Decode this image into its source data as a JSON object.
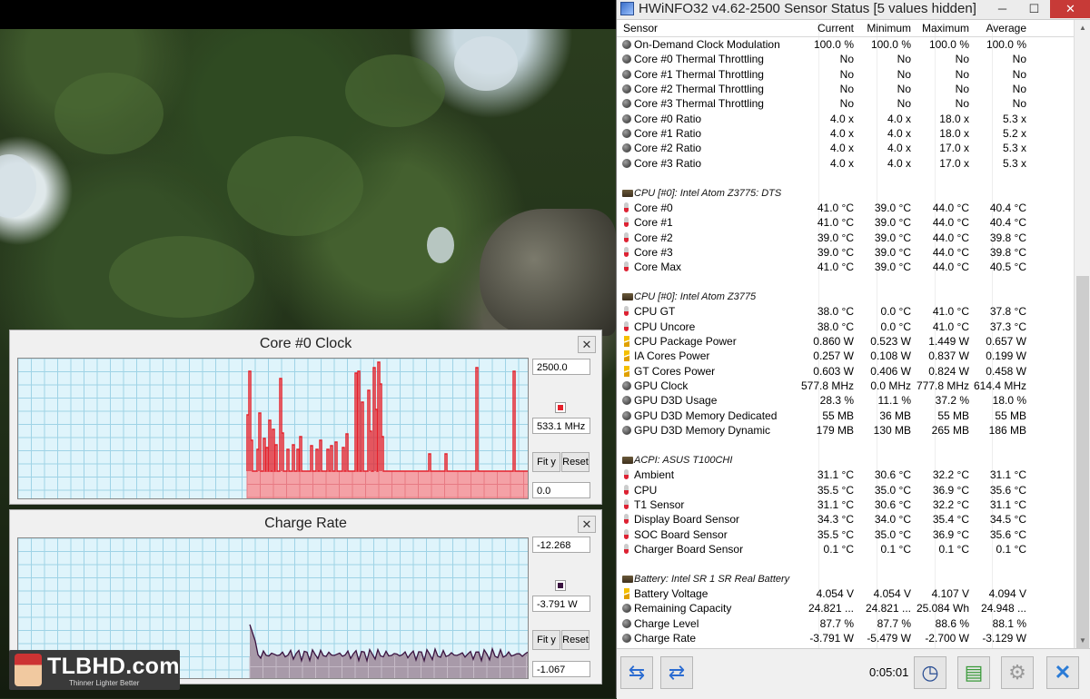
{
  "graphs": [
    {
      "title": "Core #0 Clock",
      "max_value": "2500.0",
      "current_value": "533.1 MHz",
      "min_value": "0.0",
      "fit_label": "Fit y",
      "reset_label": "Reset",
      "close_label": "✕",
      "color": "#e5212b",
      "fill": "#f4a1a6"
    },
    {
      "title": "Charge Rate",
      "max_value": "-12.268",
      "current_value": "-3.791 W",
      "min_value": "-1.067",
      "fit_label": "Fit y",
      "reset_label": "Reset",
      "close_label": "✕",
      "color": "#3a1340",
      "fill": "#a89aa9"
    }
  ],
  "logo": {
    "brand": "TLBHD.com",
    "tagline": "Thinner Lighter Better"
  },
  "hwinfo": {
    "title": "HWiNFO32 v4.62-2500 Sensor Status [5 values hidden]",
    "columns": {
      "sensor": "Sensor",
      "current": "Current",
      "minimum": "Minimum",
      "maximum": "Maximum",
      "average": "Average"
    },
    "rows": [
      {
        "icon": "circle",
        "name": "On-Demand Clock Modulation",
        "cur": "100.0 %",
        "min": "100.0 %",
        "max": "100.0 %",
        "avg": "100.0 %"
      },
      {
        "icon": "circle",
        "name": "Core #0 Thermal Throttling",
        "cur": "No",
        "min": "No",
        "max": "No",
        "avg": "No"
      },
      {
        "icon": "circle",
        "name": "Core #1 Thermal Throttling",
        "cur": "No",
        "min": "No",
        "max": "No",
        "avg": "No"
      },
      {
        "icon": "circle",
        "name": "Core #2 Thermal Throttling",
        "cur": "No",
        "min": "No",
        "max": "No",
        "avg": "No"
      },
      {
        "icon": "circle",
        "name": "Core #3 Thermal Throttling",
        "cur": "No",
        "min": "No",
        "max": "No",
        "avg": "No"
      },
      {
        "icon": "circle",
        "name": "Core #0 Ratio",
        "cur": "4.0 x",
        "min": "4.0 x",
        "max": "18.0 x",
        "avg": "5.3 x"
      },
      {
        "icon": "circle",
        "name": "Core #1 Ratio",
        "cur": "4.0 x",
        "min": "4.0 x",
        "max": "18.0 x",
        "avg": "5.2 x"
      },
      {
        "icon": "circle",
        "name": "Core #2 Ratio",
        "cur": "4.0 x",
        "min": "4.0 x",
        "max": "17.0 x",
        "avg": "5.3 x"
      },
      {
        "icon": "circle",
        "name": "Core #3 Ratio",
        "cur": "4.0 x",
        "min": "4.0 x",
        "max": "17.0 x",
        "avg": "5.3 x"
      },
      {
        "icon": "none",
        "name": "",
        "cur": "",
        "min": "",
        "max": "",
        "avg": ""
      },
      {
        "icon": "chip",
        "group": true,
        "name": "CPU [#0]: Intel Atom Z3775: DTS",
        "cur": "",
        "min": "",
        "max": "",
        "avg": ""
      },
      {
        "icon": "therm",
        "name": "Core #0",
        "cur": "41.0 °C",
        "min": "39.0 °C",
        "max": "44.0 °C",
        "avg": "40.4 °C"
      },
      {
        "icon": "therm",
        "name": "Core #1",
        "cur": "41.0 °C",
        "min": "39.0 °C",
        "max": "44.0 °C",
        "avg": "40.4 °C"
      },
      {
        "icon": "therm",
        "name": "Core #2",
        "cur": "39.0 °C",
        "min": "39.0 °C",
        "max": "44.0 °C",
        "avg": "39.8 °C"
      },
      {
        "icon": "therm",
        "name": "Core #3",
        "cur": "39.0 °C",
        "min": "39.0 °C",
        "max": "44.0 °C",
        "avg": "39.8 °C"
      },
      {
        "icon": "therm",
        "name": "Core Max",
        "cur": "41.0 °C",
        "min": "39.0 °C",
        "max": "44.0 °C",
        "avg": "40.5 °C"
      },
      {
        "icon": "none",
        "name": "",
        "cur": "",
        "min": "",
        "max": "",
        "avg": ""
      },
      {
        "icon": "chip",
        "group": true,
        "name": "CPU [#0]: Intel Atom Z3775",
        "cur": "",
        "min": "",
        "max": "",
        "avg": ""
      },
      {
        "icon": "therm",
        "name": "CPU GT",
        "cur": "38.0 °C",
        "min": "0.0 °C",
        "max": "41.0 °C",
        "avg": "37.8 °C"
      },
      {
        "icon": "therm",
        "name": "CPU Uncore",
        "cur": "38.0 °C",
        "min": "0.0 °C",
        "max": "41.0 °C",
        "avg": "37.3 °C"
      },
      {
        "icon": "bolt",
        "name": "CPU Package Power",
        "cur": "0.860 W",
        "min": "0.523 W",
        "max": "1.449 W",
        "avg": "0.657 W"
      },
      {
        "icon": "bolt",
        "name": "IA Cores Power",
        "cur": "0.257 W",
        "min": "0.108 W",
        "max": "0.837 W",
        "avg": "0.199 W"
      },
      {
        "icon": "bolt",
        "name": "GT Cores Power",
        "cur": "0.603 W",
        "min": "0.406 W",
        "max": "0.824 W",
        "avg": "0.458 W"
      },
      {
        "icon": "circle",
        "name": "GPU Clock",
        "cur": "577.8 MHz",
        "min": "0.0 MHz",
        "max": "777.8 MHz",
        "avg": "614.4 MHz"
      },
      {
        "icon": "circle",
        "name": "GPU D3D Usage",
        "cur": "28.3 %",
        "min": "11.1 %",
        "max": "37.2 %",
        "avg": "18.0 %"
      },
      {
        "icon": "circle",
        "name": "GPU D3D Memory Dedicated",
        "cur": "55 MB",
        "min": "36 MB",
        "max": "55 MB",
        "avg": "55 MB"
      },
      {
        "icon": "circle",
        "name": "GPU D3D Memory Dynamic",
        "cur": "179 MB",
        "min": "130 MB",
        "max": "265 MB",
        "avg": "186 MB"
      },
      {
        "icon": "none",
        "name": "",
        "cur": "",
        "min": "",
        "max": "",
        "avg": ""
      },
      {
        "icon": "chip",
        "group": true,
        "name": "ACPI: ASUS T100CHI",
        "cur": "",
        "min": "",
        "max": "",
        "avg": ""
      },
      {
        "icon": "therm",
        "name": "Ambient",
        "cur": "31.1 °C",
        "min": "30.6 °C",
        "max": "32.2 °C",
        "avg": "31.1 °C"
      },
      {
        "icon": "therm",
        "name": "CPU",
        "cur": "35.5 °C",
        "min": "35.0 °C",
        "max": "36.9 °C",
        "avg": "35.6 °C"
      },
      {
        "icon": "therm",
        "name": "T1 Sensor",
        "cur": "31.1 °C",
        "min": "30.6 °C",
        "max": "32.2 °C",
        "avg": "31.1 °C"
      },
      {
        "icon": "therm",
        "name": "Display Board Sensor",
        "cur": "34.3 °C",
        "min": "34.0 °C",
        "max": "35.4 °C",
        "avg": "34.5 °C"
      },
      {
        "icon": "therm",
        "name": "SOC Board Sensor",
        "cur": "35.5 °C",
        "min": "35.0 °C",
        "max": "36.9 °C",
        "avg": "35.6 °C"
      },
      {
        "icon": "therm",
        "name": "Charger Board Sensor",
        "cur": "0.1 °C",
        "min": "0.1 °C",
        "max": "0.1 °C",
        "avg": "0.1 °C"
      },
      {
        "icon": "none",
        "name": "",
        "cur": "",
        "min": "",
        "max": "",
        "avg": ""
      },
      {
        "icon": "chip",
        "group": true,
        "name": "Battery: Intel SR 1 SR Real Battery",
        "cur": "",
        "min": "",
        "max": "",
        "avg": ""
      },
      {
        "icon": "bolt",
        "name": "Battery Voltage",
        "cur": "4.054 V",
        "min": "4.054 V",
        "max": "4.107 V",
        "avg": "4.094 V"
      },
      {
        "icon": "circle",
        "name": "Remaining Capacity",
        "cur": "24.821 ...",
        "min": "24.821 ...",
        "max": "25.084 Wh",
        "avg": "24.948 ..."
      },
      {
        "icon": "circle",
        "name": "Charge Level",
        "cur": "87.7 %",
        "min": "87.7 %",
        "max": "88.6 %",
        "avg": "88.1 %"
      },
      {
        "icon": "circle",
        "name": "Charge Rate",
        "cur": "-3.791 W",
        "min": "-5.479 W",
        "max": "-2.700 W",
        "avg": "-3.129 W"
      }
    ],
    "timer": "0:05:01"
  }
}
